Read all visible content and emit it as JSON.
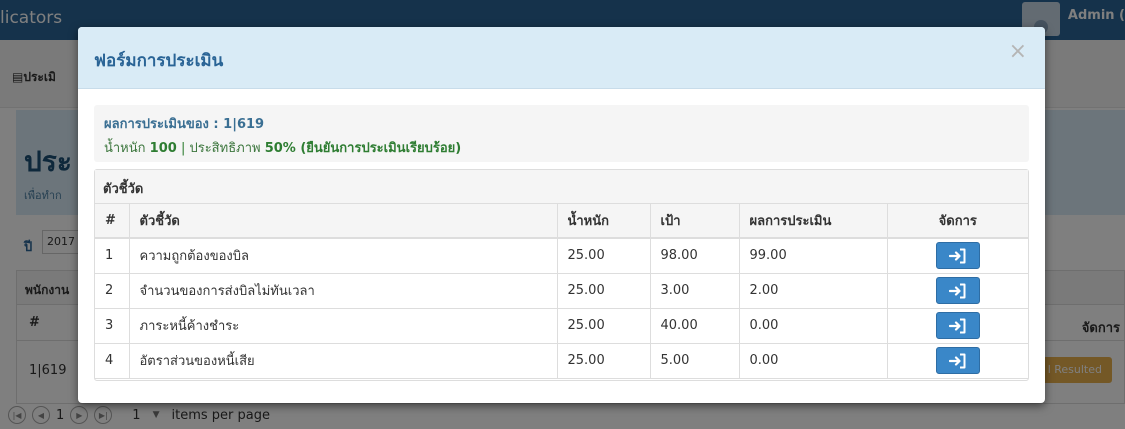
{
  "background": {
    "brand": "licators",
    "user_name": "Admin (",
    "menu": "ประเมิ",
    "jumbotron_title": "ประ",
    "jumbotron_sub": "เพื่อทำก",
    "year_label": "ปี",
    "year_value": "2017",
    "table_heading": "พนักงาน",
    "col_hash": "#",
    "col_action": "จัดการ",
    "row_id": "1|619",
    "resulted_label": "l Resulted",
    "pager": {
      "page": "1",
      "page_size": "1",
      "items_per_page": "items per page"
    }
  },
  "modal": {
    "title": "ฟอร์มการประเมิน",
    "close": "×",
    "summary": {
      "result_of_label": "ผลการประเมินของ : 1|619",
      "weight_label": "น้ำหนัก",
      "weight_value": "100",
      "separator": "|",
      "efficiency_label": "ประสิทธิภาพ",
      "efficiency_value": "50% (ยืนยันการประเมินเรียบร้อย)"
    },
    "panel_heading": "ตัวชี้วัด",
    "columns": [
      "#",
      "ตัวชี้วัด",
      "น้ำหนัก",
      "เป้า",
      "ผลการประเมิน",
      "จัดการ"
    ],
    "rows": [
      {
        "num": "1",
        "name": "ความถูกต้องของบิล",
        "weight": "25.00",
        "target": "98.00",
        "result": "99.00"
      },
      {
        "num": "2",
        "name": "จำนวนของการส่งบิลไม่ทันเวลา",
        "weight": "25.00",
        "target": "3.00",
        "result": "2.00"
      },
      {
        "num": "3",
        "name": "ภาระหนี้ค้างชำระ",
        "weight": "25.00",
        "target": "40.00",
        "result": "0.00"
      },
      {
        "num": "4",
        "name": "อัตราส่วนของหนี้เสีย",
        "weight": "25.00",
        "target": "5.00",
        "result": "0.00"
      }
    ]
  },
  "colors": {
    "header_bg": "#d9ebf6",
    "title": "#2a6496",
    "action_button": "#3a87c8",
    "success_text": "#2e7d32"
  }
}
